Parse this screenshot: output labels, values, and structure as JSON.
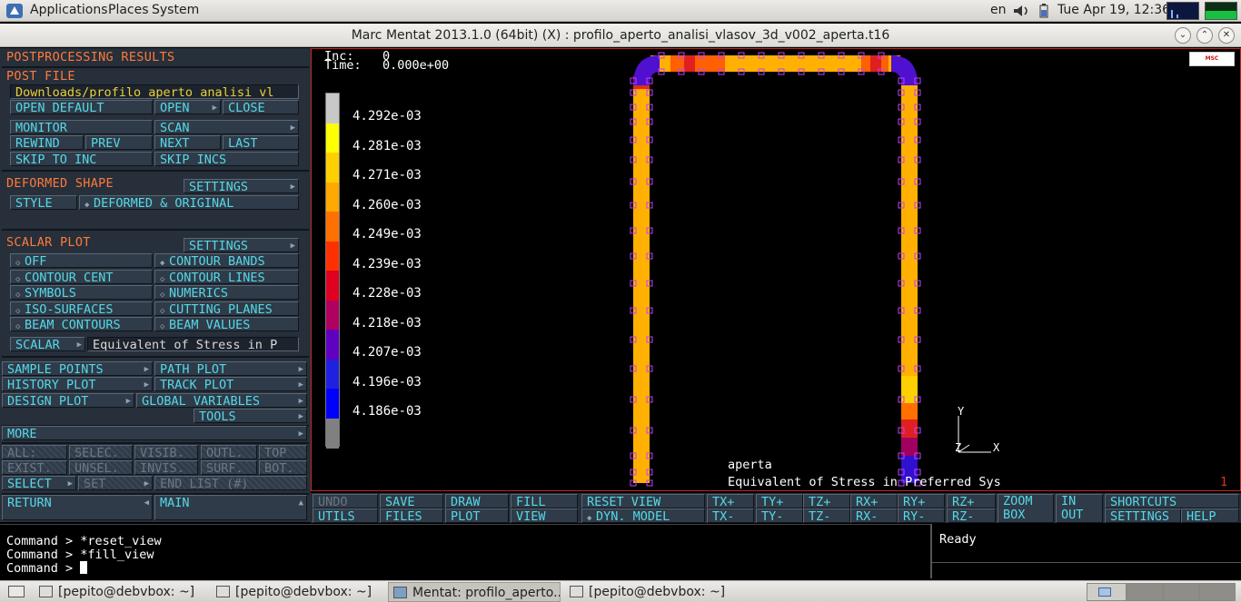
{
  "top_panel": {
    "menus": [
      "Applications",
      "Places",
      "System"
    ],
    "keyboard_layout": "en",
    "clock": "Tue Apr 19, 12:36"
  },
  "window": {
    "title": "Marc Mentat 2013.1.0 (64bit) (X) : profilo_aperto_analisi_vlasov_3d_v002_aperta.t16"
  },
  "left_panel": {
    "header": "POSTPROCESSING RESULTS",
    "post_file": {
      "title": "POST FILE",
      "path": "Downloads/profilo_aperto_analisi_vl",
      "open_default": "OPEN DEFAULT",
      "open": "OPEN",
      "close": "CLOSE",
      "monitor": "MONITOR",
      "scan": "SCAN",
      "rewind": "REWIND",
      "prev": "PREV",
      "next": "NEXT",
      "last": "LAST",
      "skip_to_inc": "SKIP TO INC",
      "skip_incs": "SKIP INCS"
    },
    "deformed_shape": {
      "title": "DEFORMED SHAPE",
      "settings": "SETTINGS",
      "style_label": "STYLE",
      "style_value": "DEFORMED & ORIGINAL"
    },
    "scalar_plot": {
      "title": "SCALAR PLOT",
      "settings": "SETTINGS",
      "off": "OFF",
      "contour_bands": "CONTOUR BANDS",
      "contour_cent": "CONTOUR CENT",
      "contour_lines": "CONTOUR LINES",
      "symbols": "SYMBOLS",
      "numerics": "NUMERICS",
      "iso_surfaces": "ISO-SURFACES",
      "cutting_planes": "CUTTING PLANES",
      "beam_contours": "BEAM CONTOURS",
      "beam_values": "BEAM VALUES",
      "scalar_label": "SCALAR",
      "scalar_value": "Equivalent of Stress in P"
    },
    "plots": {
      "sample_points": "SAMPLE POINTS",
      "path_plot": "PATH PLOT",
      "history_plot": "HISTORY PLOT",
      "track_plot": "TRACK PLOT",
      "design_plot": "DESIGN PLOT",
      "global_variables": "GLOBAL VARIABLES",
      "tools": "TOOLS"
    },
    "more": "MORE",
    "select_row1": [
      "ALL:",
      "SELEC.",
      "VISIB.",
      "OUTL.",
      "TOP"
    ],
    "select_row2": [
      "EXIST.",
      "UNSEL.",
      "INVIS.",
      "SURF.",
      "BOT."
    ],
    "select": "SELECT",
    "set": "SET",
    "end_list": "END LIST (#)",
    "return": "RETURN",
    "main": "MAIN"
  },
  "viewport": {
    "inc_label": "Inc:",
    "inc_value": "0",
    "time_label": "Time:",
    "time_value": "0.000e+00",
    "legend": [
      "4.292e-03",
      "4.281e-03",
      "4.271e-03",
      "4.260e-03",
      "4.249e-03",
      "4.239e-03",
      "4.228e-03",
      "4.218e-03",
      "4.207e-03",
      "4.196e-03",
      "4.186e-03"
    ],
    "legend_colors": [
      "#c8c8c8",
      "#ffff00",
      "#ffd000",
      "#ffa800",
      "#ff7000",
      "#ff3000",
      "#e00020",
      "#b00060",
      "#6000c0",
      "#2020e0",
      "#0000ff",
      "#808080"
    ],
    "job_name": "aperta",
    "scalar_name": "Equivalent of Stress in Preferred Sys",
    "page_number": "1",
    "axis_y": "Y",
    "axis_x": "X",
    "axis_z": "Z",
    "logo": "MSC Software"
  },
  "toolbar": {
    "row1": [
      "UNDO",
      "SAVE",
      "DRAW",
      "FILL",
      "RESET VIEW",
      "TX+",
      "TY+",
      "TZ+",
      "RX+",
      "RY+",
      "RZ+",
      "ZOOM",
      "IN",
      "SHORTCUTS"
    ],
    "row2": [
      "UTILS",
      "FILES",
      "PLOT",
      "VIEW",
      "DYN. MODEL",
      "TX-",
      "TY-",
      "TZ-",
      "RX-",
      "RY-",
      "RZ-",
      "BOX",
      "OUT",
      "SETTINGS",
      "HELP"
    ]
  },
  "command": {
    "lines": [
      "Command > *reset_view",
      "Command > *fill_view",
      "Command > "
    ],
    "status": "Ready"
  },
  "taskbar": {
    "tasks": [
      "[pepito@debvbox: ~]",
      "[pepito@debvbox: ~]",
      "Mentat: profilo_aperto...",
      "[pepito@debvbox: ~]"
    ]
  }
}
